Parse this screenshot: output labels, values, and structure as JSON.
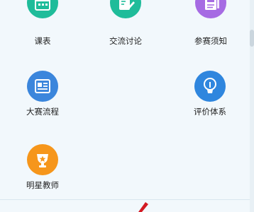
{
  "grid": {
    "items": [
      {
        "label": "课表",
        "icon": "calendar-icon",
        "color": "#1fbc9a"
      },
      {
        "label": "交流讨论",
        "icon": "edit-icon",
        "color": "#1fbc9a"
      },
      {
        "label": "参赛须知",
        "icon": "notice-icon",
        "color": "#a66be3"
      },
      {
        "label": "大赛流程",
        "icon": "process-icon",
        "color": "#3b86dc"
      },
      {
        "label": "评价体系",
        "icon": "evaluation-icon",
        "color": "#2f86de"
      },
      {
        "label": "明星教师",
        "icon": "star-teacher-icon",
        "color": "#f6961b"
      }
    ]
  }
}
